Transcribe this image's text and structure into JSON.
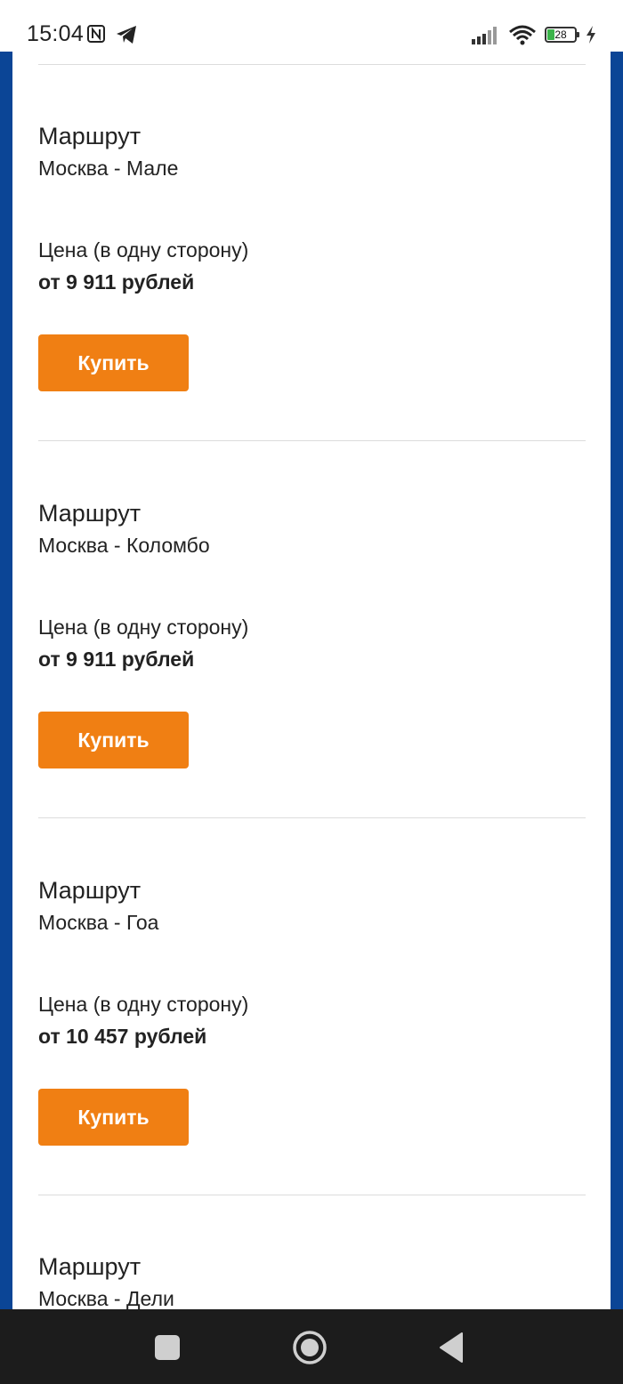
{
  "status_bar": {
    "time": "15:04",
    "battery_level": "28",
    "battery_fraction": 0.28
  },
  "offers": [
    {
      "route_label": "Маршрут",
      "route": "Москва - Мале",
      "price_label": "Цена (в одну сторону)",
      "price": "от 9 911 рублей",
      "buy_label": "Купить"
    },
    {
      "route_label": "Маршрут",
      "route": "Москва - Коломбо",
      "price_label": "Цена (в одну сторону)",
      "price": "от 9 911 рублей",
      "buy_label": "Купить"
    },
    {
      "route_label": "Маршрут",
      "route": "Москва - Гоа",
      "price_label": "Цена (в одну сторону)",
      "price": "от 10 457 рублей",
      "buy_label": "Купить"
    },
    {
      "route_label": "Маршрут",
      "route": "Москва - Дели"
    }
  ],
  "colors": {
    "accent": "#f07f13",
    "frame": "#0b4596",
    "nav_bar": "#1c1c1c"
  },
  "icons": {
    "status": [
      "nfc-icon",
      "telegram-icon",
      "signal-icon",
      "wifi-icon",
      "battery-icon",
      "charging-icon"
    ],
    "nav": [
      "recents-icon",
      "home-icon",
      "back-icon"
    ]
  }
}
